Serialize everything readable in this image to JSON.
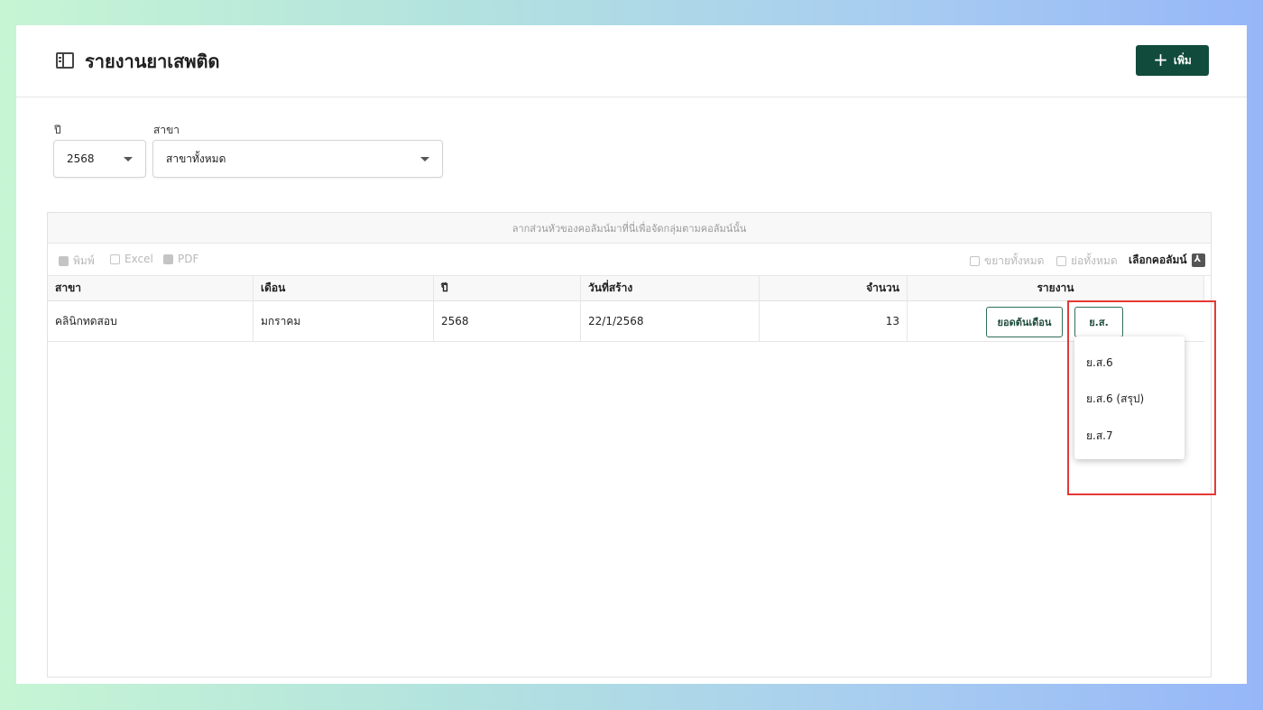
{
  "header": {
    "title": "รายงานยาเสพติด",
    "add_label": "เพิ่ม"
  },
  "filters": {
    "year_label": "ปี",
    "year_value": "2568",
    "branch_label": "สาขา",
    "branch_value": "สาขาทั้งหมด"
  },
  "grid": {
    "group_panel_text": "ลากส่วนหัวของคอลัมน์มาที่นี่เพื่อจัดกลุ่มตามคอลัมน์นั้น",
    "toolbar": {
      "print": "พิมพ์",
      "excel": "Excel",
      "pdf": "PDF",
      "expand_all": "ขยายทั้งหมด",
      "collapse_all": "ย่อทั้งหมด",
      "choose_columns": "เลือกคอลัมน์"
    },
    "columns": [
      "สาขา",
      "เดือน",
      "ปี",
      "วันที่สร้าง",
      "จำนวน",
      "รายงาน"
    ],
    "rows": [
      {
        "branch": "คลินิกทดสอบ",
        "month": "มกราคม",
        "year": "2568",
        "created": "22/1/2568",
        "amount": "13",
        "btn_opening": "ยอดต้นเดือน",
        "btn_report": "ย.ส."
      }
    ]
  },
  "report_menu": {
    "items": [
      "ย.ส.6",
      "ย.ส.6 (สรุป)",
      "ย.ส.7"
    ]
  },
  "colors": {
    "primary": "#114b3b",
    "highlight": "#e53935"
  }
}
